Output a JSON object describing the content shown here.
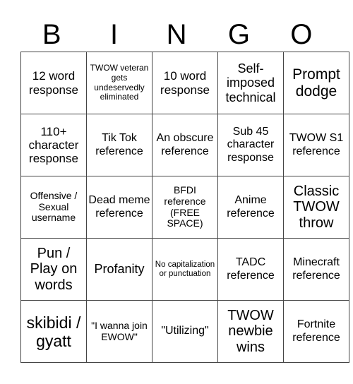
{
  "header": {
    "letters": [
      "B",
      "I",
      "N",
      "G",
      "O"
    ]
  },
  "grid": {
    "rows": [
      [
        "12 word response",
        "TWOW veteran gets undeservedly eliminated",
        "10 word response",
        "Self-imposed technical",
        "Prompt dodge"
      ],
      [
        "110+ character response",
        "Tik Tok reference",
        "An obscure reference",
        "Sub 45 character response",
        "TWOW S1 reference"
      ],
      [
        "Offensive / Sexual username",
        "Dead meme reference",
        "BFDI reference (FREE SPACE)",
        "Anime reference",
        "Classic TWOW throw"
      ],
      [
        "Pun / Play on words",
        "Profanity",
        "No capitalization or punctuation",
        "TADC reference",
        "Minecraft reference"
      ],
      [
        "skibidi / gyatt",
        "\"I wanna join EWOW\"",
        "\"Utilizing\"",
        "TWOW newbie wins",
        "Fortnite reference"
      ]
    ],
    "free_space": "BFDI reference (FREE SPACE)"
  }
}
